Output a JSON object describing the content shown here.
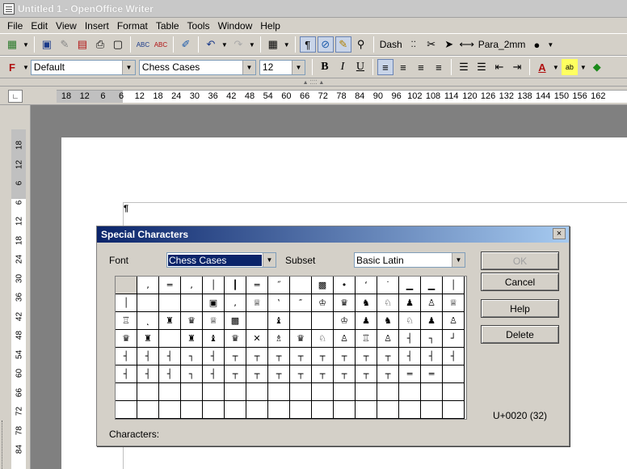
{
  "window": {
    "title": "Untitled 1 - OpenOffice Writer"
  },
  "menu": {
    "items": [
      "File",
      "Edit",
      "View",
      "Insert",
      "Format",
      "Table",
      "Tools",
      "Window",
      "Help"
    ]
  },
  "toolbar1": {
    "dash_label": "Dash",
    "para_label": "Para_2mm"
  },
  "toolbar2": {
    "style_value": "Default",
    "font_value": "Chess Cases",
    "size_value": "12"
  },
  "ruler": {
    "h_ticks": [
      "18",
      "12",
      "6",
      "6",
      "12",
      "18",
      "24",
      "30",
      "36",
      "42",
      "48",
      "54",
      "60",
      "66",
      "72",
      "78",
      "84",
      "90",
      "96",
      "102",
      "108",
      "114",
      "120",
      "126",
      "132",
      "138",
      "144",
      "150",
      "156",
      "162"
    ],
    "v_ticks": [
      "18",
      "12",
      "6",
      "6",
      "12",
      "18",
      "24",
      "30",
      "36",
      "42",
      "48",
      "54",
      "60",
      "66",
      "72",
      "78",
      "84"
    ]
  },
  "dialog": {
    "title": "Special Characters",
    "close_glyph": "×",
    "font_label": "Font",
    "font_value": "Chess Cases",
    "subset_label": "Subset",
    "subset_value": "Basic Latin",
    "ok_label": "OK",
    "cancel_label": "Cancel",
    "help_label": "Help",
    "delete_label": "Delete",
    "unicode_value": "U+0020 (32)",
    "characters_label": "Characters:"
  },
  "characters": [
    "",
    "‚",
    "═",
    "‚",
    "│",
    "┃",
    "═",
    "˝",
    "",
    "▩",
    "•",
    "‘",
    "˙",
    "▁",
    "▁",
    "│",
    "│",
    "",
    "",
    "",
    "▣",
    "‚",
    "♕",
    "‛",
    "″",
    "♔",
    "♛",
    "♞",
    "♘",
    "♟",
    "♙",
    "♕",
    "♖",
    "˛",
    "♜",
    "♛",
    "♕",
    "▩",
    "",
    "♝",
    "",
    "",
    "♔",
    "♟",
    "♞",
    "♘",
    "♟",
    "♙",
    "♛",
    "♜",
    "",
    "♜",
    "♝",
    "♛",
    "✕",
    "♗",
    "♛",
    "♘",
    "♙",
    "♖",
    "♙",
    "┤",
    "┐",
    "┘",
    "┤",
    "┤",
    "┤",
    "┐",
    "┤",
    "┬",
    "┬",
    "┬",
    "┬",
    "┬",
    "┬",
    "┬",
    "┬",
    "┤",
    "┤",
    "┤",
    "┤",
    "┤",
    "┤",
    "┐",
    "┤",
    "┬",
    "┬",
    "┬",
    "┬",
    "┬",
    "┬",
    "┬",
    "┬",
    "═",
    "═",
    "",
    "",
    "",
    "",
    "",
    "",
    "",
    "",
    "",
    "",
    "",
    "",
    "",
    "",
    "",
    "",
    "",
    "",
    "",
    "",
    "",
    "",
    "",
    "",
    "",
    "",
    "",
    "",
    "",
    "",
    "",
    "",
    ""
  ]
}
